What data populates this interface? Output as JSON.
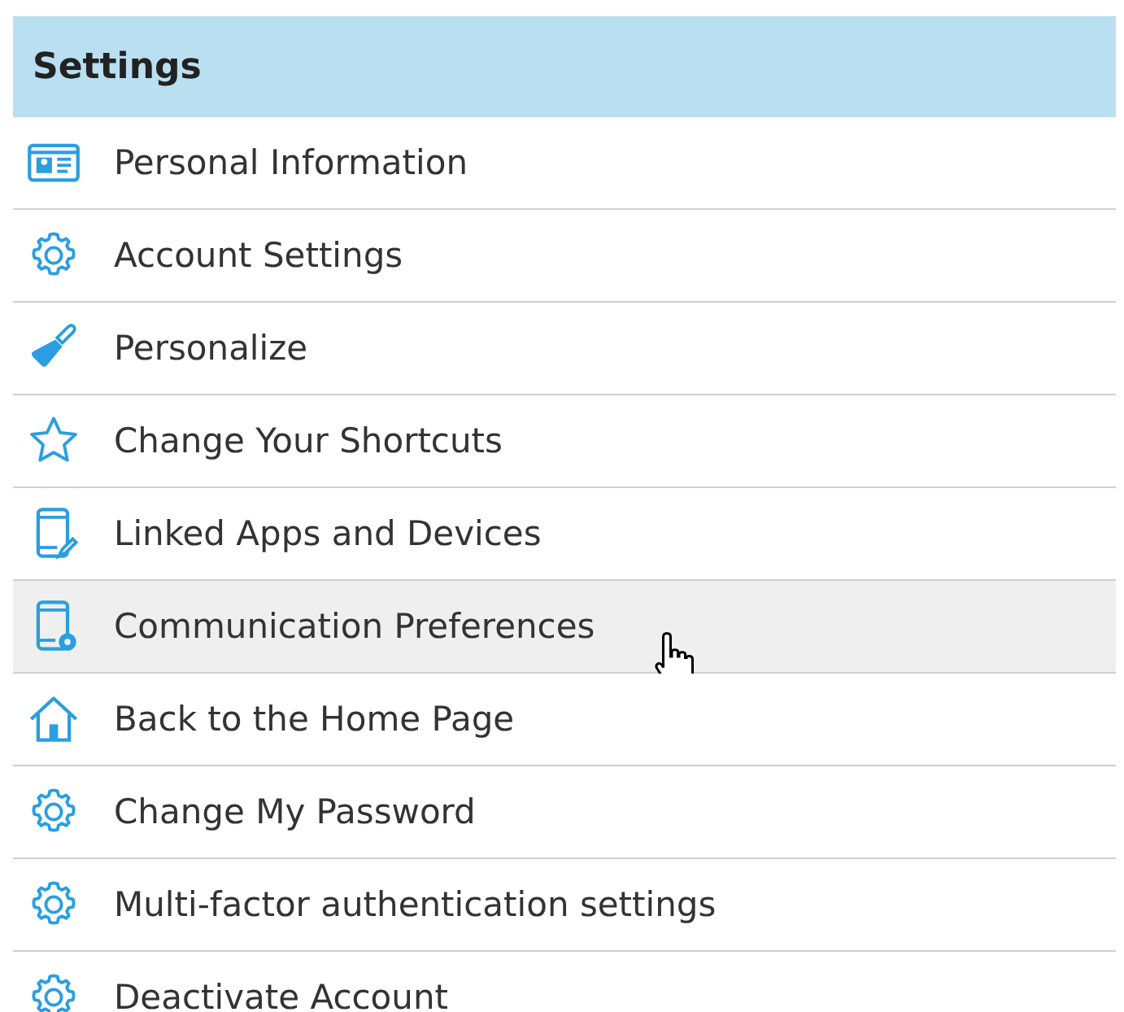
{
  "panel": {
    "title": "Settings",
    "items": [
      {
        "kind": "card",
        "label": "Personal Information",
        "hovered": false
      },
      {
        "kind": "gear",
        "label": "Account Settings",
        "hovered": false
      },
      {
        "kind": "brush",
        "label": "Personalize",
        "hovered": false
      },
      {
        "kind": "star",
        "label": "Change Your Shortcuts",
        "hovered": false
      },
      {
        "kind": "phone",
        "label": "Linked Apps and Devices",
        "hovered": false
      },
      {
        "kind": "device",
        "label": "Communication Preferences",
        "hovered": true
      },
      {
        "kind": "home",
        "label": "Back to the Home Page",
        "hovered": false
      },
      {
        "kind": "gear",
        "label": "Change My Password",
        "hovered": false
      },
      {
        "kind": "gear",
        "label": "Multi-factor authentication settings",
        "hovered": false
      },
      {
        "kind": "gear",
        "label": "Deactivate Account",
        "hovered": false
      }
    ]
  }
}
